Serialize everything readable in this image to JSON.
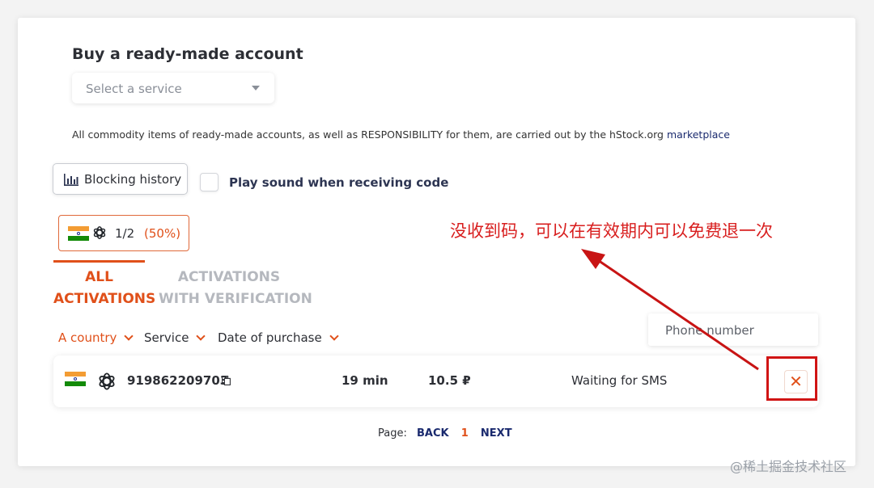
{
  "header": {
    "title": "Buy a ready-made account"
  },
  "service_select": {
    "placeholder": "Select a service"
  },
  "notice": {
    "text": "All commodity items of ready-made accounts, as well as RESPONSIBILITY for them, are carried out by the hStock.org",
    "link": "marketplace"
  },
  "controls": {
    "blocking_history_label": "Blocking history",
    "play_sound_label": "Play sound when receiving code",
    "play_sound_checked": false
  },
  "counter": {
    "ratio": "1/2",
    "percent": "(50%)"
  },
  "tabs": [
    {
      "label_line1": "ALL",
      "label_line2": "ACTIVATIONS",
      "active": true
    },
    {
      "label_line1": "ACTIVATIONS",
      "label_line2": "WITH VERIFICATION",
      "active": false
    }
  ],
  "filters": {
    "country": "A country",
    "service": "Service",
    "date": "Date of purchase",
    "phone_placeholder": "Phone number"
  },
  "activations": [
    {
      "country_flag": "india-flag",
      "service_icon": "openai-icon",
      "phone": "919862209703",
      "time_left": "19 min",
      "price": "10.5 ₽",
      "status": "Waiting for SMS"
    }
  ],
  "pagination": {
    "label": "Page:",
    "back": "BACK",
    "current": "1",
    "next": "NEXT"
  },
  "annotation": {
    "text": "没收到码，可以在有效期内可以免费退一次"
  },
  "watermark": "@稀土掘金技术社区",
  "colors": {
    "accent": "#e0501a",
    "annotation_red": "#d81e1e",
    "link_navy": "#1a2a6e"
  }
}
